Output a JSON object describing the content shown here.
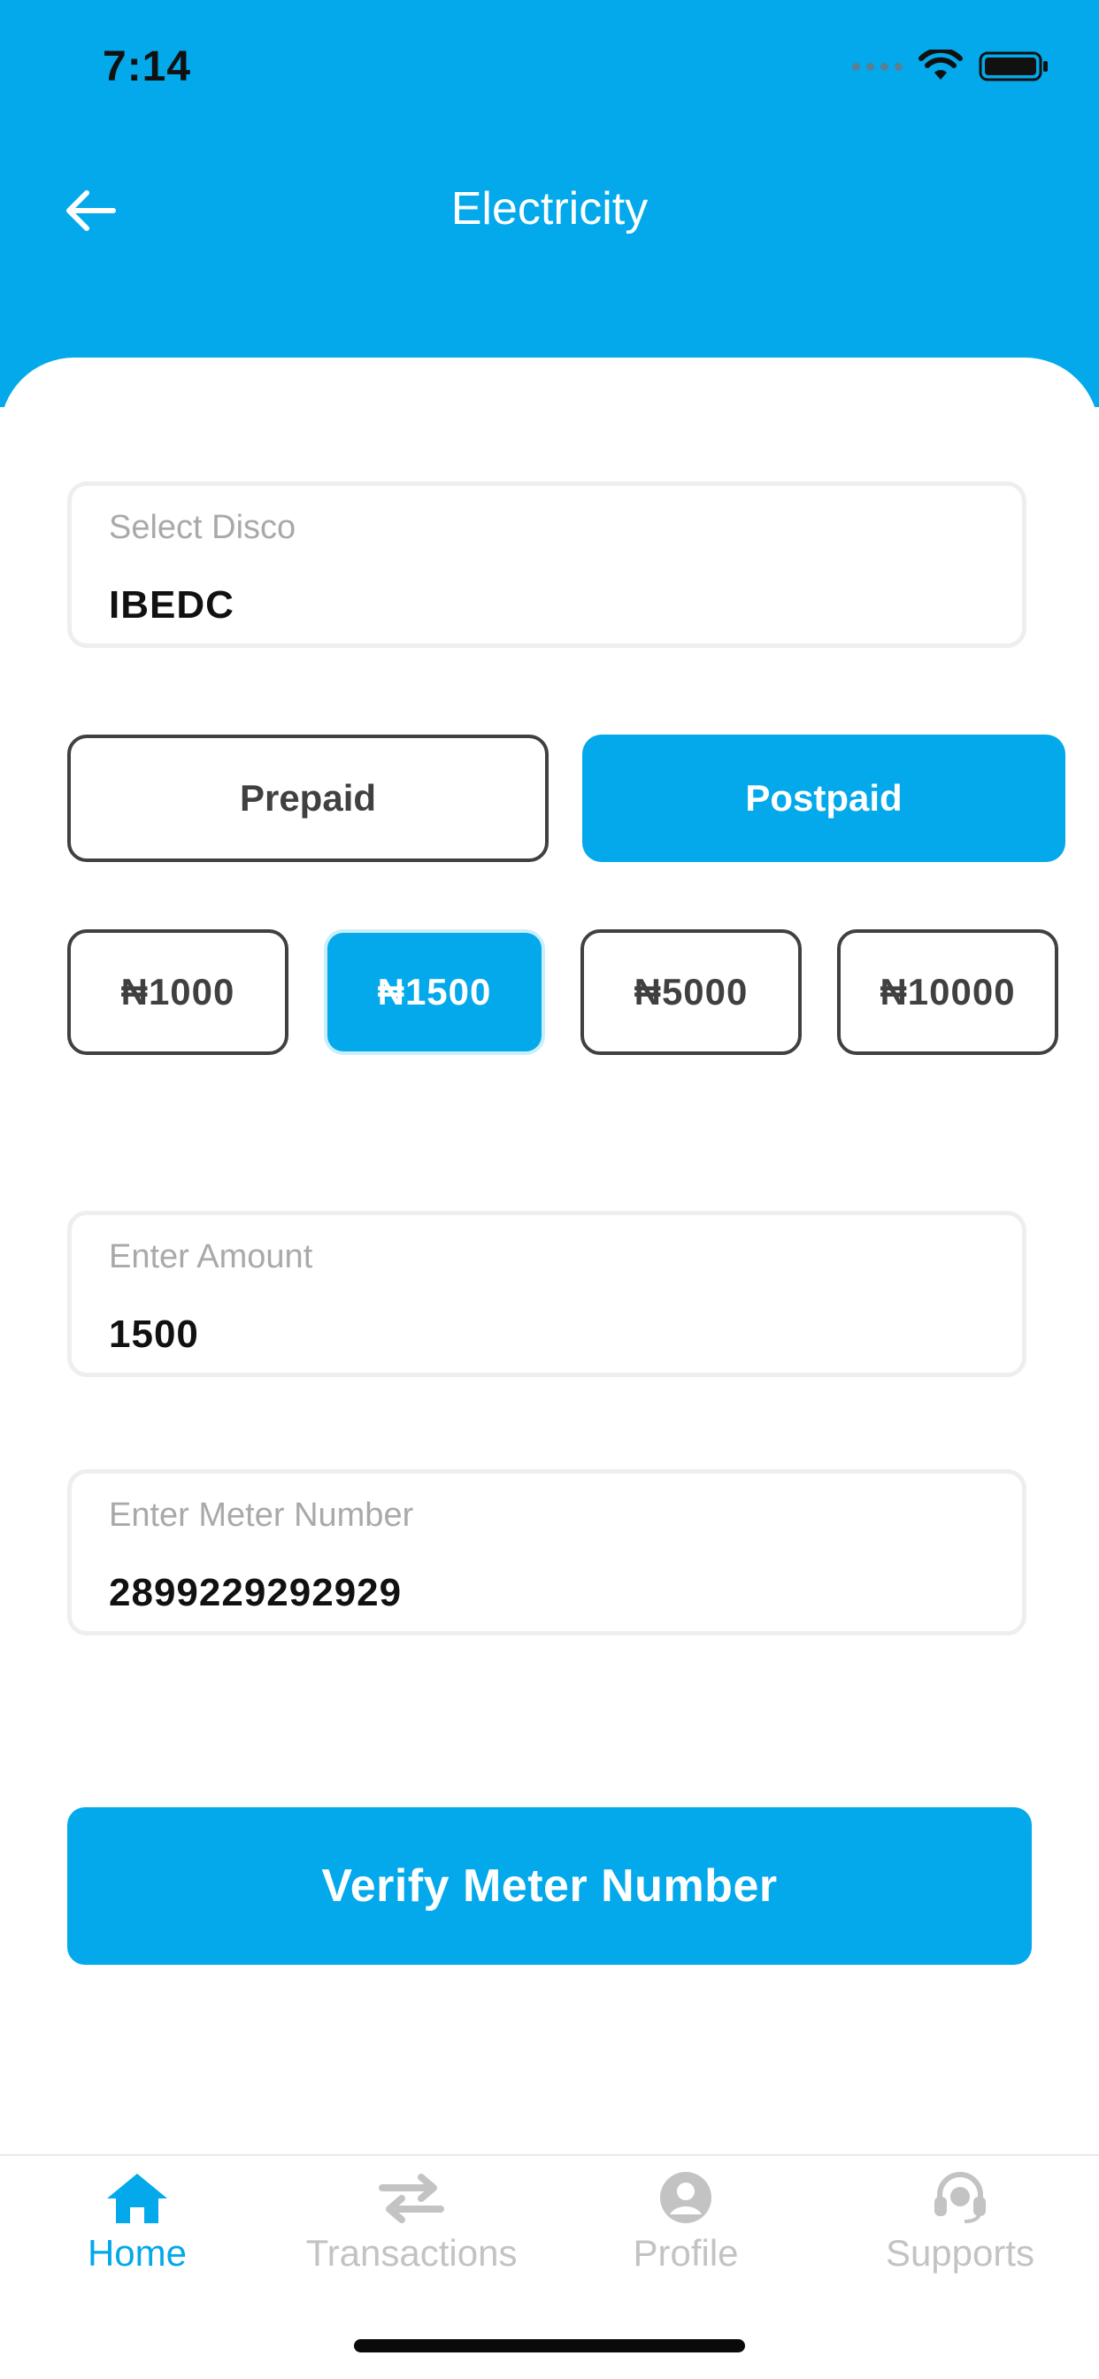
{
  "status_bar": {
    "time": "7:14"
  },
  "header": {
    "title": "Electricity",
    "back_icon": "arrow-left-icon"
  },
  "form": {
    "disco": {
      "label": "Select Disco",
      "value": "IBEDC"
    },
    "meter_type": {
      "options": [
        "Prepaid",
        "Postpaid"
      ],
      "selected": "Postpaid"
    },
    "quick_amounts": {
      "options": [
        "₦1000",
        "₦1500",
        "₦5000",
        "₦10000"
      ],
      "selected": "₦1500"
    },
    "amount": {
      "label": "Enter Amount",
      "value": "1500"
    },
    "meter_number": {
      "label": "Enter Meter Number",
      "value": "2899229292929"
    },
    "submit_label": "Verify Meter Number"
  },
  "tab_bar": {
    "active": "Home",
    "items": [
      {
        "label": "Home",
        "icon": "home-icon"
      },
      {
        "label": "Transactions",
        "icon": "transfer-arrows-icon"
      },
      {
        "label": "Profile",
        "icon": "user-icon"
      },
      {
        "label": "Supports",
        "icon": "headset-icon"
      }
    ]
  },
  "colors": {
    "accent": "#03a9ea",
    "text": "#111111",
    "placeholder": "#a9a9a9",
    "inactive_tab": "#c3c3c3"
  }
}
